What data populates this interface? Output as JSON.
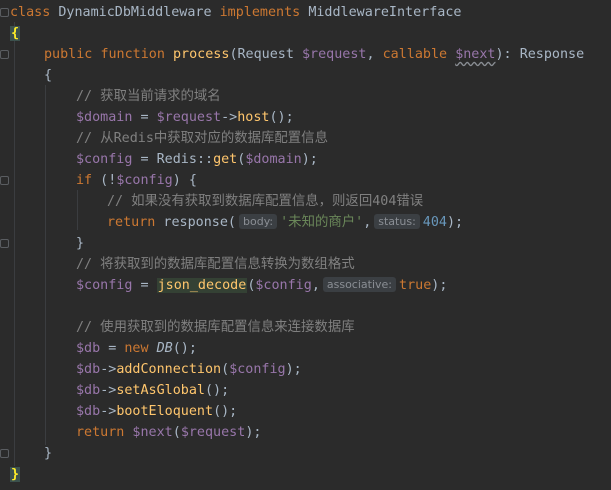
{
  "code": {
    "l1": {
      "kw_class": "class",
      "class_name": "DynamicDbMiddleware",
      "kw_impl": "implements",
      "iface": "MiddlewareInterface"
    },
    "l2": {
      "brace": "{"
    },
    "l3": {
      "kw_public": "public",
      "kw_function": "function",
      "fn_name": "process",
      "p_open": "(",
      "type_request": "Request",
      "var_request": "$request",
      "comma1": ", ",
      "type_callable": "callable",
      "var_next": "$next",
      "p_close": "): ",
      "ret_type": "Response"
    },
    "l4": {
      "brace": "{"
    },
    "l5": {
      "comment": "// 获取当前请求的域名"
    },
    "l6": {
      "var_domain": "$domain",
      "op": " = ",
      "var_request": "$request",
      "arrow": "->",
      "method": "host",
      "tail": "();"
    },
    "l7": {
      "comment": "// 从Redis中获取对应的数据库配置信息"
    },
    "l8": {
      "var_config": "$config",
      "op": " = ",
      "cls": "Redis",
      "dcolon": "::",
      "method": "get",
      "p_open": "(",
      "var_domain": "$domain",
      "tail": ");"
    },
    "l9": {
      "kw_if": "if",
      "p_open": " (!",
      "var_config": "$config",
      "tail": ") {"
    },
    "l10": {
      "comment": "// 如果没有获取到数据库配置信息，则返回404错误"
    },
    "l11": {
      "kw_return": "return",
      "fn": " response(",
      "hint_body": "body:",
      "str": "'未知的商户'",
      "comma": ",",
      "hint_status": "status:",
      "num": "404",
      "tail": ");"
    },
    "l12": {
      "brace": "}"
    },
    "l13": {
      "comment": "// 将获取到的数据库配置信息转换为数组格式"
    },
    "l14": {
      "var_config": "$config",
      "op": " = ",
      "fn": "json_decode",
      "p_open": "(",
      "var_config2": "$config",
      "comma": ",",
      "hint_assoc": "associative:",
      "kw_true": "true",
      "tail": ");"
    },
    "l16": {
      "comment": "// 使用获取到的数据库配置信息来连接数据库"
    },
    "l17": {
      "var_db": "$db",
      "op": " = ",
      "kw_new": "new",
      "cls": " DB",
      "tail": "();"
    },
    "l18": {
      "var_db": "$db",
      "arrow": "->",
      "method": "addConnection",
      "p_open": "(",
      "var_config": "$config",
      "tail": ");"
    },
    "l19": {
      "var_db": "$db",
      "arrow": "->",
      "method": "setAsGlobal",
      "tail": "();"
    },
    "l20": {
      "var_db": "$db",
      "arrow": "->",
      "method": "bootEloquent",
      "tail": "();"
    },
    "l21": {
      "kw_return": "return",
      "var_next": " $next",
      "p_open": "(",
      "var_request": "$request",
      "tail": ");"
    },
    "l22": {
      "brace": "}"
    },
    "l23": {
      "brace": "}"
    }
  },
  "colors": {
    "background": "#2b2b2b",
    "keyword": "#cc7832",
    "function": "#ffc66d",
    "variable": "#9876aa",
    "comment": "#808080",
    "string": "#6a8759",
    "number": "#6897bb",
    "text": "#a9b7c6"
  }
}
